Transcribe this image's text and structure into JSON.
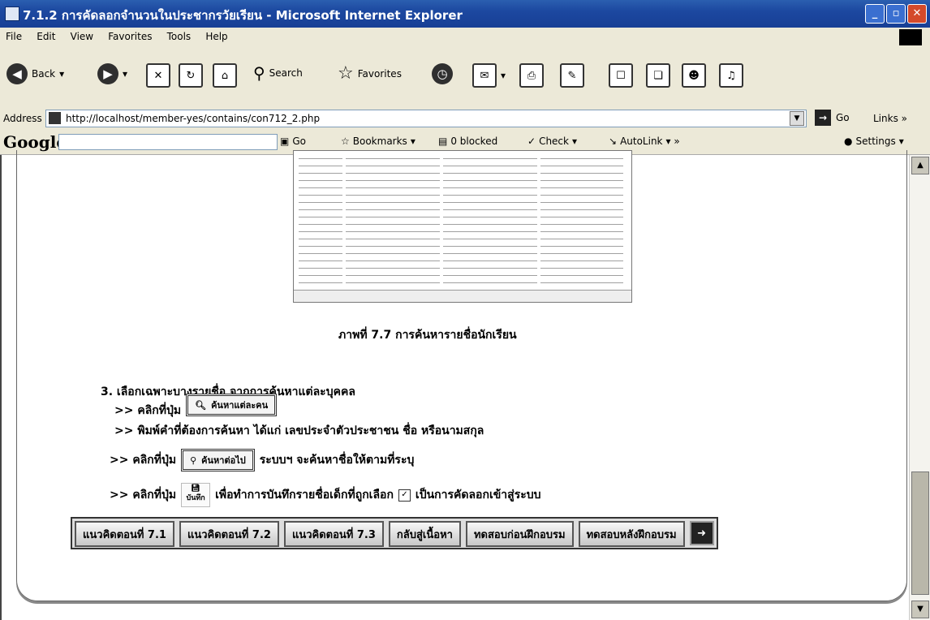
{
  "window": {
    "title": "7.1.2 การคัดลอกจำนวนในประชากรวัยเรียน - Microsoft Internet Explorer"
  },
  "menu": [
    "File",
    "Edit",
    "View",
    "Favorites",
    "Tools",
    "Help"
  ],
  "toolbar": {
    "back": "Back",
    "search": "Search",
    "favorites": "Favorites"
  },
  "address": {
    "label": "Address",
    "url": "http://localhost/member-yes/contains/con712_2.php",
    "go": "Go",
    "links": "Links"
  },
  "googlebar": {
    "logo": "Google",
    "g_label": "G",
    "go": "Go",
    "bookmarks": "Bookmarks",
    "blocked": "0 blocked",
    "check": "Check",
    "autolink": "AutoLink",
    "settings": "Settings"
  },
  "content": {
    "caption": "ภาพที่ 7.7 การค้นหารายชื่อนักเรียน",
    "step3": "3. เลือกเฉพาะบางรายชื่อ จากการค้นหาแต่ละบุคคล",
    "line1_pre": ">> คลิกที่ปุ่ม",
    "btn_search_person": "ค้นหาแต่ละคน",
    "line2": ">> พิมพ์คำที่ต้องการค้นหา ได้แก่ เลขประจำตัวประชาชน ชื่อ หรือนามสกุล",
    "line3_pre": ">> คลิกที่ปุ่ม",
    "btn_search_next": "ค้นหาต่อไป",
    "line3_post": "ระบบฯ จะค้นหาชื่อให้ตามที่ระบุ",
    "line4_pre": ">> คลิกที่ปุ่ม",
    "save_label": "บันทึก",
    "line4_mid": "เพื่อทำการบันทึกรายชื่อเด็กที่ถูกเลือก",
    "line4_post": "เป็นการคัดลอกเข้าสู่ระบบ"
  },
  "nav": [
    "แนวคิดตอนที่ 7.1",
    "แนวคิดตอนที่ 7.2",
    "แนวคิดตอนที่ 7.3",
    "กลับสู่เนื้อหา",
    "ทดสอบก่อนฝึกอบรม",
    "ทดสอบหลังฝึกอบรม"
  ]
}
